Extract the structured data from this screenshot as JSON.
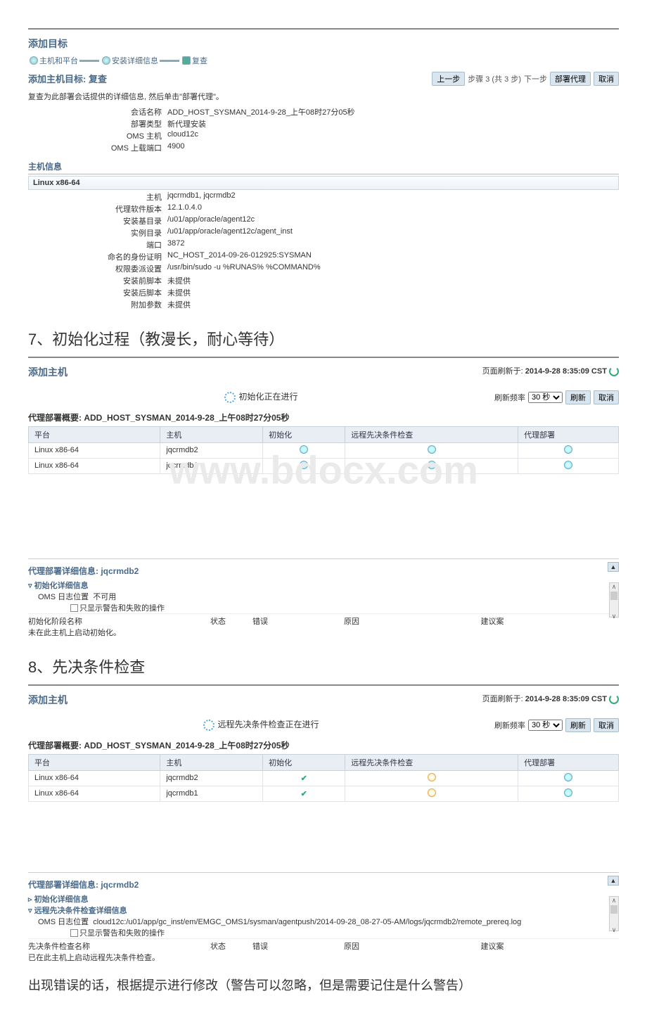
{
  "section1": {
    "title": "添加目标",
    "steps": [
      "主机和平台",
      "安装详细信息",
      "复查"
    ],
    "subtitle": "添加主机目标: 复查",
    "toolbar": {
      "prev": "上一步",
      "step_text": "步骤 3 (共 3 步)",
      "next": "下一步",
      "deploy": "部署代理",
      "cancel": "取消"
    },
    "desc": "复查为此部署会话提供的详细信息, 然后单击\"部署代理\"。",
    "kv": [
      {
        "k": "会话名称",
        "v": "ADD_HOST_SYSMAN_2014-9-28_上午08时27分05秒"
      },
      {
        "k": "部署类型",
        "v": "新代理安装"
      },
      {
        "k": "OMS 主机",
        "v": "cloud12c"
      },
      {
        "k": "OMS 上载端口",
        "v": "4900"
      }
    ],
    "host_info_title": "主机信息",
    "platform_label": "Linux x86-64",
    "kv2": [
      {
        "k": "主机",
        "v": "jqcrmdb1, jqcrmdb2"
      },
      {
        "k": "代理软件版本",
        "v": "12.1.0.4.0"
      },
      {
        "k": "安装基目录",
        "v": "/u01/app/oracle/agent12c"
      },
      {
        "k": "实例目录",
        "v": "/u01/app/oracle/agent12c/agent_inst"
      },
      {
        "k": "端口",
        "v": "3872"
      },
      {
        "k": "命名的身份证明",
        "v": "NC_HOST_2014-09-26-012925:SYSMAN"
      },
      {
        "k": "权限委派设置",
        "v": "/usr/bin/sudo -u %RUNAS% %COMMAND%"
      },
      {
        "k": "安装前脚本",
        "v": "未提供"
      },
      {
        "k": "安装后脚本",
        "v": "未提供"
      },
      {
        "k": "附加参数",
        "v": "未提供"
      }
    ]
  },
  "heading7": "7、初始化过程（教漫长，耐心等待）",
  "watermark": "www.bdocx.com",
  "section2": {
    "title": "添加主机",
    "page_refresh_label": "页面刷新于:",
    "page_refresh_time": "2014-9-28 8:35:09 CST",
    "status_text": "初始化正在进行",
    "refresh_label": "刷新频率",
    "refresh_value": "30 秒",
    "refresh_btn": "刷新",
    "cancel_btn": "取消",
    "summary_prefix": "代理部署概要:",
    "summary_value": "ADD_HOST_SYSMAN_2014-9-28_上午08时27分05秒",
    "columns": [
      "平台",
      "主机",
      "初始化",
      "远程先决条件检查",
      "代理部署"
    ],
    "rows": [
      {
        "platform": "Linux x86-64",
        "host": "jqcrmdb2",
        "init": "clock",
        "precheck": "clock",
        "deploy": "clock"
      },
      {
        "platform": "Linux x86-64",
        "host": "jqcrmdb1",
        "init": "clock",
        "precheck": "clock",
        "deploy": "clock"
      }
    ],
    "detail_title": "代理部署详细信息: jqcrmdb2",
    "expand_label": "初始化详细信息",
    "oms_log_label": "OMS 日志位置",
    "oms_log_value": "不可用",
    "checkbox_label": "只显示警告和失败的操作",
    "foot_cols": {
      "c1": "初始化阶段名称",
      "c2": "状态",
      "c3": "错误",
      "c4": "原因",
      "c5": "建议案"
    },
    "foot_msg": "未在此主机上启动初始化。"
  },
  "heading8": "8、先决条件检查",
  "section3": {
    "title": "添加主机",
    "page_refresh_label": "页面刷新于:",
    "page_refresh_time": "2014-9-28 8:35:09 CST",
    "status_text": "远程先决条件检查正在进行",
    "refresh_label": "刷新频率",
    "refresh_value": "30 秒",
    "refresh_btn": "刷新",
    "cancel_btn": "取消",
    "summary_prefix": "代理部署概要:",
    "summary_value": "ADD_HOST_SYSMAN_2014-9-28_上午08时27分05秒",
    "columns": [
      "平台",
      "主机",
      "初始化",
      "远程先决条件检查",
      "代理部署"
    ],
    "rows": [
      {
        "platform": "Linux x86-64",
        "host": "jqcrmdb2",
        "init": "check",
        "precheck": "clock-y",
        "deploy": "clock"
      },
      {
        "platform": "Linux x86-64",
        "host": "jqcrmdb1",
        "init": "check",
        "precheck": "clock-y",
        "deploy": "clock"
      }
    ],
    "detail_title": "代理部署详细信息: jqcrmdb2",
    "collapse1": "初始化详细信息",
    "expand2": "远程先决条件检查详细信息",
    "oms_log_label": "OMS 日志位置",
    "oms_log_value": "cloud12c:/u01/app/gc_inst/em/EMGC_OMS1/sysman/agentpush/2014-09-28_08-27-05-AM/logs/jqcrmdb2/remote_prereq.log",
    "checkbox_label": "只显示警告和失败的操作",
    "foot_cols": {
      "c1": "先决条件检查名称",
      "c2": "状态",
      "c3": "错误",
      "c4": "原因",
      "c5": "建议案"
    },
    "foot_msg": "已在此主机上启动远程先决条件检查。"
  },
  "note": "出现错误的话，根据提示进行修改（警告可以忽略，但是需要记住是什么警告）"
}
